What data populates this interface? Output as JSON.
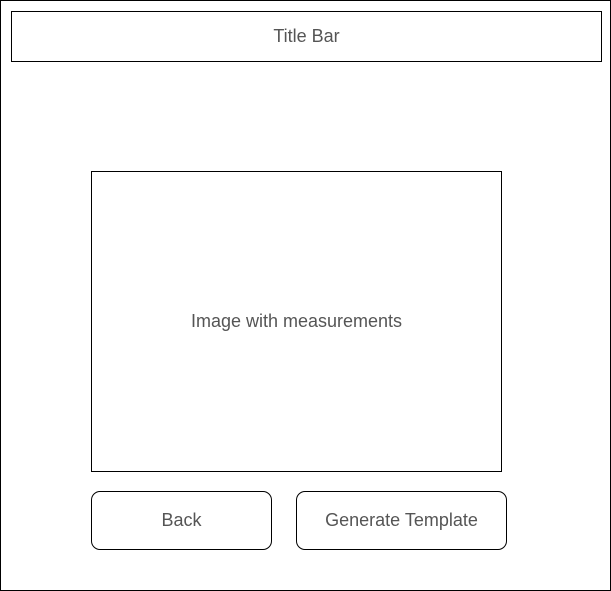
{
  "window": {
    "title": "Title Bar"
  },
  "main": {
    "image_placeholder": "Image with measurements"
  },
  "actions": {
    "back_label": "Back",
    "generate_label": "Generate Template"
  }
}
